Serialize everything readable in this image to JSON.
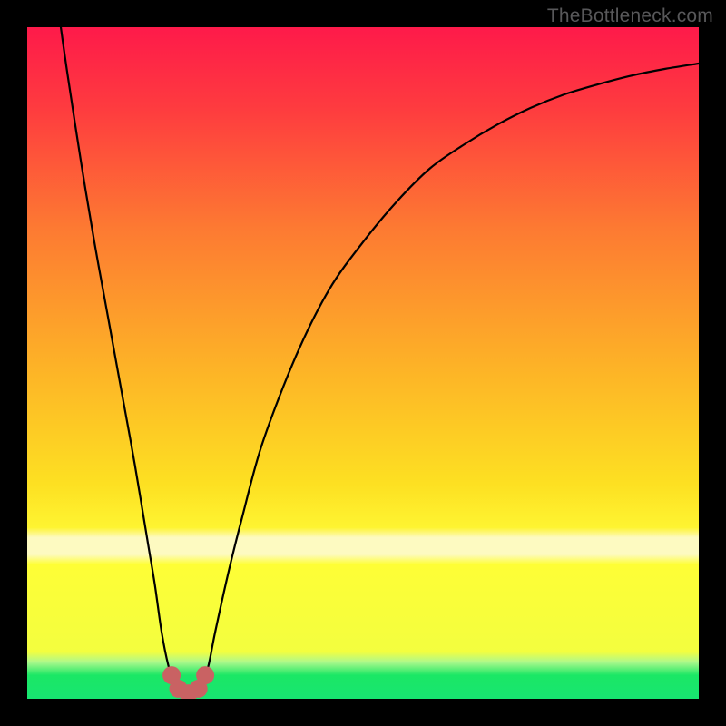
{
  "watermark": "TheBottleneck.com",
  "chart_data": {
    "type": "line",
    "title": "",
    "xlabel": "",
    "ylabel": "",
    "xlim": [
      0,
      100
    ],
    "ylim": [
      0,
      100
    ],
    "series": [
      {
        "name": "curve",
        "x": [
          5,
          6,
          8,
          10,
          12,
          14,
          16,
          18,
          19,
          20,
          21,
          22,
          23,
          24,
          25,
          26,
          27,
          28,
          30,
          32,
          35,
          40,
          45,
          50,
          55,
          60,
          65,
          70,
          75,
          80,
          85,
          90,
          95,
          100
        ],
        "y": [
          100,
          93,
          80,
          68,
          57,
          46,
          35,
          23,
          17,
          10,
          5,
          2,
          0.5,
          0,
          0.5,
          2,
          5,
          10,
          19,
          27,
          38,
          51,
          61,
          68,
          74,
          79,
          82.5,
          85.5,
          88,
          90,
          91.5,
          92.8,
          93.8,
          94.6
        ]
      }
    ],
    "markers": {
      "name": "minimum-cluster",
      "color": "#c96263",
      "points": [
        {
          "x": 21.5,
          "y": 3.5,
          "r": 10
        },
        {
          "x": 22.5,
          "y": 1.5,
          "r": 10
        },
        {
          "x": 24.0,
          "y": 0.8,
          "r": 10
        },
        {
          "x": 25.5,
          "y": 1.5,
          "r": 10
        },
        {
          "x": 26.5,
          "y": 3.5,
          "r": 10
        }
      ]
    },
    "bands": [
      {
        "name": "pale-yellow",
        "y0": 21.5,
        "y1": 25.5,
        "color": "#fdfac1"
      },
      {
        "name": "light-green",
        "y0": 3.5,
        "y1": 5.5,
        "color": "#aef98c"
      },
      {
        "name": "green",
        "y0": 0,
        "y1": 3.5,
        "color": "#1be765"
      }
    ],
    "background_gradient": {
      "top": "#fe1a4a",
      "mid": "#fec924",
      "low": "#fefe36",
      "bottom": "#1be765"
    }
  }
}
